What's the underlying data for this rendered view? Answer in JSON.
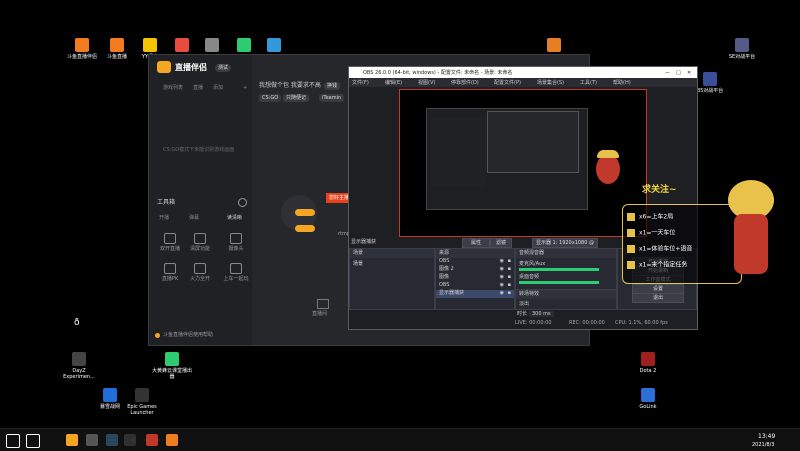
{
  "desktop": {
    "left_icons": [
      {
        "label": "斗鱼直播伴侣",
        "color": "#f27b20"
      },
      {
        "label": "斗鱼直播",
        "color": "#f27b20"
      },
      {
        "label": "YY语音",
        "color": "#f5c400"
      },
      {
        "label": "",
        "color": "#e74c3c"
      },
      {
        "label": "",
        "color": "#888888"
      },
      {
        "label": "",
        "color": "#2ecc71"
      },
      {
        "label": "",
        "color": "#3498db"
      }
    ],
    "right_icons": [
      {
        "label": "",
        "color": "#e67e22"
      },
      {
        "label": "SE对战平台",
        "color": "#555a88"
      },
      {
        "label": "B5对战平台",
        "color": "#3a4e9a"
      },
      {
        "label": "Dota 2",
        "color": "#a02020"
      },
      {
        "label": "GoLink",
        "color": "#2d6fd6"
      }
    ],
    "bottom_icons": [
      {
        "label": "DayZ Experimen...",
        "color": "#444444"
      },
      {
        "label": "大黄蜂云课堂播出器",
        "color": "#2ecc71"
      },
      {
        "label": "暴雪战网",
        "color": "#1e6fd9"
      },
      {
        "label": "Epic Games Launcher",
        "color": "#333333"
      }
    ]
  },
  "live_app": {
    "title": "直播伴侣",
    "badge": "测试",
    "sidebar_tabs": [
      "游戏列表",
      "直播",
      "添加",
      "+"
    ],
    "empty_hint": "CS:GO模式下未能识别游戏画面",
    "section_title": "工具箱",
    "section_items": [
      "开播",
      "弹幕",
      "读清晰"
    ],
    "tools": [
      {
        "label": "双开直播"
      },
      {
        "label": "清屏功能"
      },
      {
        "label": "摄像头"
      },
      {
        "label": "直播PK"
      },
      {
        "label": "火力全开"
      },
      {
        "label": "上车一起玩"
      }
    ],
    "footer": "斗鱼直播伴侣使用帮助",
    "main_header": "我想做个包 我要求不高",
    "main_tag": "换钱",
    "tags": [
      "CS:GO",
      "只随便记",
      "iTeamin"
    ],
    "rtmp": "rtmp",
    "popup": "您好主播，请用直播伴侣开播",
    "popup_btn": "开始直播",
    "bottom_action": "直播间"
  },
  "obs": {
    "title": "OBS 26.0.0 (64-bit, windows) - 配置文件: 未命名 - 场景: 未命名",
    "menus": [
      "文件(F)",
      "编辑(E)",
      "视图(V)",
      "停靠部件(D)",
      "配置文件(P)",
      "场景集合(S)",
      "工具(T)",
      "帮助(H)"
    ],
    "display_label": "显示器捕获",
    "props_btn": "属性",
    "filters_btn": "滤镜",
    "display_select": "显示器 1: 1920x1080 @ 0,0",
    "scenes_header": "场景",
    "scenes": [
      "场景"
    ],
    "sources_header": "来源",
    "sources": [
      "OBS",
      "图像 2",
      "图像",
      "OBS",
      "显示器捕获"
    ],
    "mixer_header": "音频混音器",
    "mixer_items": [
      "麦克风/Aux",
      "桌面音频"
    ],
    "transitions_header": "转场特效",
    "transition": "淡出",
    "duration_label": "时长",
    "duration": "300 ms",
    "controls": [
      "开始推流",
      "开始录制",
      "工作室模式",
      "设置",
      "退出"
    ],
    "status": {
      "live": "LIVE: 00:00:00",
      "rec": "REC: 00:00:00",
      "cpu": "CPU: 1.1%, 60.00 fps"
    }
  },
  "overlay": {
    "follow": "求关注~",
    "notes": [
      "x6=上车2局",
      "x1=一天车位",
      "x1=体验车位+语音",
      "x1=来个指定任务"
    ]
  },
  "taskbar": {
    "time": "13:49",
    "date": "2021/8/3",
    "icons": [
      {
        "name": "windows-start-icon",
        "color": "#ffffff"
      },
      {
        "name": "search-icon",
        "color": "#ffffff"
      },
      {
        "name": "douyu-app-icon",
        "color": "#f5a623"
      },
      {
        "name": "obs-app-icon",
        "color": "#555555"
      },
      {
        "name": "steam-app-icon",
        "color": "#2a475e"
      },
      {
        "name": "obs-app-icon-2",
        "color": "#303030"
      },
      {
        "name": "red-app-icon",
        "color": "#c0392b"
      },
      {
        "name": "orange-app-icon",
        "color": "#f27b20"
      }
    ]
  },
  "colors": {
    "accent": "#f5a623",
    "obs_border": "#c0392b",
    "popup": "#e8421c"
  }
}
